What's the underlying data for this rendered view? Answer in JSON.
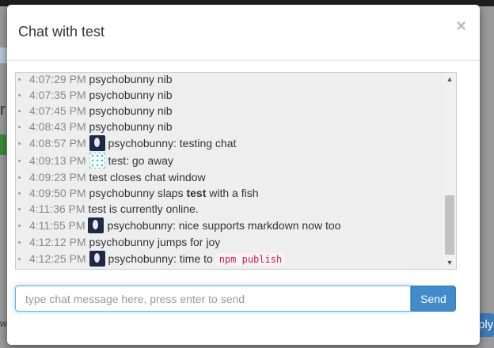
{
  "modal": {
    "title": "Chat with test",
    "close_label": "×"
  },
  "messages": [
    {
      "time": "4:07:29 PM",
      "text": "psychobunny nib"
    },
    {
      "time": "4:07:35 PM",
      "text": "psychobunny nib"
    },
    {
      "time": "4:07:45 PM",
      "text": "psychobunny nib"
    },
    {
      "time": "4:08:43 PM",
      "text": "psychobunny nib"
    },
    {
      "time": "4:08:57 PM",
      "user": "psychobunny",
      "text": "testing chat"
    },
    {
      "time": "4:09:13 PM",
      "user": "test",
      "text": "go away"
    },
    {
      "time": "4:09:23 PM",
      "text": "test closes chat window"
    },
    {
      "time": "4:09:50 PM",
      "pre": "psychobunny slaps",
      "bold": "test",
      "post": "with a fish"
    },
    {
      "time": "4:11:36 PM",
      "text": "test is currently online."
    },
    {
      "time": "4:11:55 PM",
      "user": "psychobunny",
      "text": "nice supports markdown now too"
    },
    {
      "time": "4:12:12 PM",
      "text": "psychobunny jumps for joy"
    },
    {
      "time": "4:12:25 PM",
      "user": "psychobunny",
      "text": "time to",
      "code": "npm publish"
    }
  ],
  "scroll": {
    "up": "▲",
    "down": "▼"
  },
  "input": {
    "placeholder": "type chat message here, press enter to send",
    "value": ""
  },
  "send_label": "Send",
  "background": {
    "letter": "r",
    "right_button": "ply",
    "left_text": "ws"
  }
}
